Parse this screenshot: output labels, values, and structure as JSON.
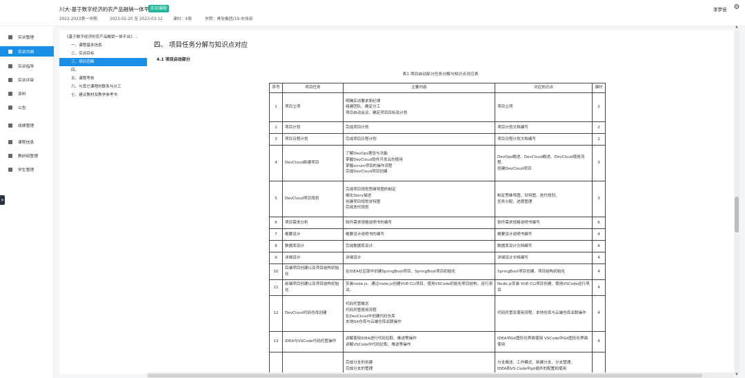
{
  "header": {
    "title": "川大-基于数字经济的农产品融销一体平台",
    "tag": "实训课程",
    "semester": "2022-2023第一学期",
    "date_range": "2023-02-20 至 2023-03-12",
    "duration": "课时：4周",
    "school": "学院：青软集团/19-市场部",
    "user": "李梦佳",
    "settings_icon": "gear-icon"
  },
  "sidebar": {
    "items": [
      {
        "label": "实训管理",
        "icon": "folder-icon",
        "active": false
      },
      {
        "label": "实训大纲",
        "icon": "list-icon",
        "active": true
      },
      {
        "label": "实训指导",
        "icon": "book-icon",
        "active": false
      },
      {
        "label": "实训评审",
        "icon": "review-icon",
        "active": false
      },
      {
        "label": "资料",
        "icon": "document-icon",
        "active": false
      },
      {
        "label": "公告",
        "icon": "bell-icon",
        "active": false
      },
      {
        "label": "成绩管理",
        "icon": "chart-icon",
        "active": false
      },
      {
        "label": "课程信息",
        "icon": "info-icon",
        "active": false
      },
      {
        "label": "教研组管理",
        "icon": "team-icon",
        "active": false
      },
      {
        "label": "学生管理",
        "icon": "user-icon",
        "active": false
      }
    ],
    "expand_icon": "chevron-right-icon",
    "expand_glyph": "»"
  },
  "toc": {
    "root": "《基于数字经济的农产品融销一体平台》...",
    "items": [
      {
        "label": "一、课程基本信息",
        "active": false
      },
      {
        "label": "二、实训目标",
        "active": false
      },
      {
        "label": "三、项目范畴",
        "active": true
      },
      {
        "label": "四、",
        "active": false
      },
      {
        "label": "五、课程考核",
        "active": false
      },
      {
        "label": "六、与其它课程的联系与分工",
        "active": false
      },
      {
        "label": "七、建议教材及教学参考书",
        "active": false
      }
    ]
  },
  "content": {
    "section_title": "四、 项目任务分解与知识点对应",
    "subsection_title": "4.1 项目启动部分",
    "table_caption": "表1 项目启动部分任务分解与知识点对应表",
    "table": {
      "headers": [
        "序号",
        "项目任务",
        "主要内容",
        "对应知识点",
        "课时"
      ],
      "rows": [
        {
          "no": "1",
          "task": "项目立项",
          "content": [
            "明确实训要求和纪律",
            "组建团队、确定分工",
            "项目启动会议、确定项目目标及计划"
          ],
          "knowledge": [
            "项目立项"
          ],
          "hours": "2"
        },
        {
          "no": "2",
          "task": "项目计划",
          "content": [
            "完成项目计划"
          ],
          "knowledge": [
            "项目计划文档编写"
          ],
          "hours": "2"
        },
        {
          "no": "3",
          "task": "项目日程计划",
          "content": [
            "完成项目日程计划"
          ],
          "knowledge": [
            "项目日程计划文档编写"
          ],
          "hours": "2"
        },
        {
          "no": "4",
          "task": "DevCloud新建项目",
          "content": [
            "了解DevOps理念与功能",
            "掌握DevCloud软件开发云的使用",
            "掌握scrum项目的操作流程",
            "完成DevCloud项目创建"
          ],
          "knowledge": [
            "DevOps概述、DevCloud概述、DevCloud使用流程、",
            "创建DevCloud项目"
          ],
          "hours": "3"
        },
        {
          "no": "5",
          "task": "DevCloud项目规划",
          "content": [
            "完成项目规划思维导图的制定",
            "细化Story描述",
            "创建项目规划甘特图",
            "完成迭代规划"
          ],
          "knowledge": [
            "制定思维导图、甘特图、迭代规划、",
            "任务分配、进度管理"
          ],
          "hours": "3"
        },
        {
          "no": "6",
          "task": "项目需求分析",
          "content": [
            "软件需求规格说明书的编写"
          ],
          "knowledge": [
            "软件需求规格说明书编写"
          ],
          "hours": "6"
        },
        {
          "no": "7",
          "task": "概要设计",
          "content": [
            "概要设计说明书的编写"
          ],
          "knowledge": [
            "概要设计说明书编写"
          ],
          "hours": "4"
        },
        {
          "no": "8",
          "task": "数据库设计",
          "content": [
            "完成数据库设计"
          ],
          "knowledge": [
            "数据库设计文档编写"
          ],
          "hours": "4"
        },
        {
          "no": "9",
          "task": "详细设计",
          "content": [
            "详细设计"
          ],
          "knowledge": [
            "详细设计文档编写"
          ],
          "hours": "4"
        },
        {
          "no": "10",
          "task": "后端项目创建以及项目结构初始化",
          "content": [
            "在IDEA社区版中创建SpringBoot项目、SpringBoot项目初始化"
          ],
          "knowledge": [
            "SpringBoot项目创建、项目结构初始化"
          ],
          "hours": "4"
        },
        {
          "no": "11",
          "task": "前端项目创建以及项目结构初始化",
          "content": [
            "安装node.js、通过node.js创建VUE-CLI项目、使用VSCode初始化项目结构、运行测试。"
          ],
          "knowledge": [
            "Node.js安装 VUE-CLI项目创建、使用VSCode运行项目"
          ],
          "hours": "4"
        },
        {
          "no": "12",
          "task": "DevCloud代码仓库创建",
          "content": [
            "代码托管概念",
            "代码托管使用流程",
            "在DevCloud中创建代码仓库",
            "本地Git仓库与云端仓库关联操作"
          ],
          "knowledge": [
            "代码托管及使用流程、本地仓库与云端仓库关联操作"
          ],
          "hours": "4"
        },
        {
          "no": "13",
          "task": "IDEA与VSCode代码托管操作",
          "content": [
            "讲解使用IDEA进行代码拉取、推送等操作",
            "讲解VSCode中代码拉取、推送等操作"
          ],
          "knowledge": [
            "IDEA中Git图形化界面使用 VSCode中Git图形化界面使用"
          ],
          "hours": "4"
        },
        {
          "no": "",
          "task": "",
          "content": [
            "完成分支的创建",
            "完成分支的管理"
          ],
          "knowledge": [
            "分支概述、工作模式、新建分支、分支管理、",
            "IDEA和VS Code中git插件的配置和使用"
          ],
          "hours": ""
        }
      ]
    }
  }
}
